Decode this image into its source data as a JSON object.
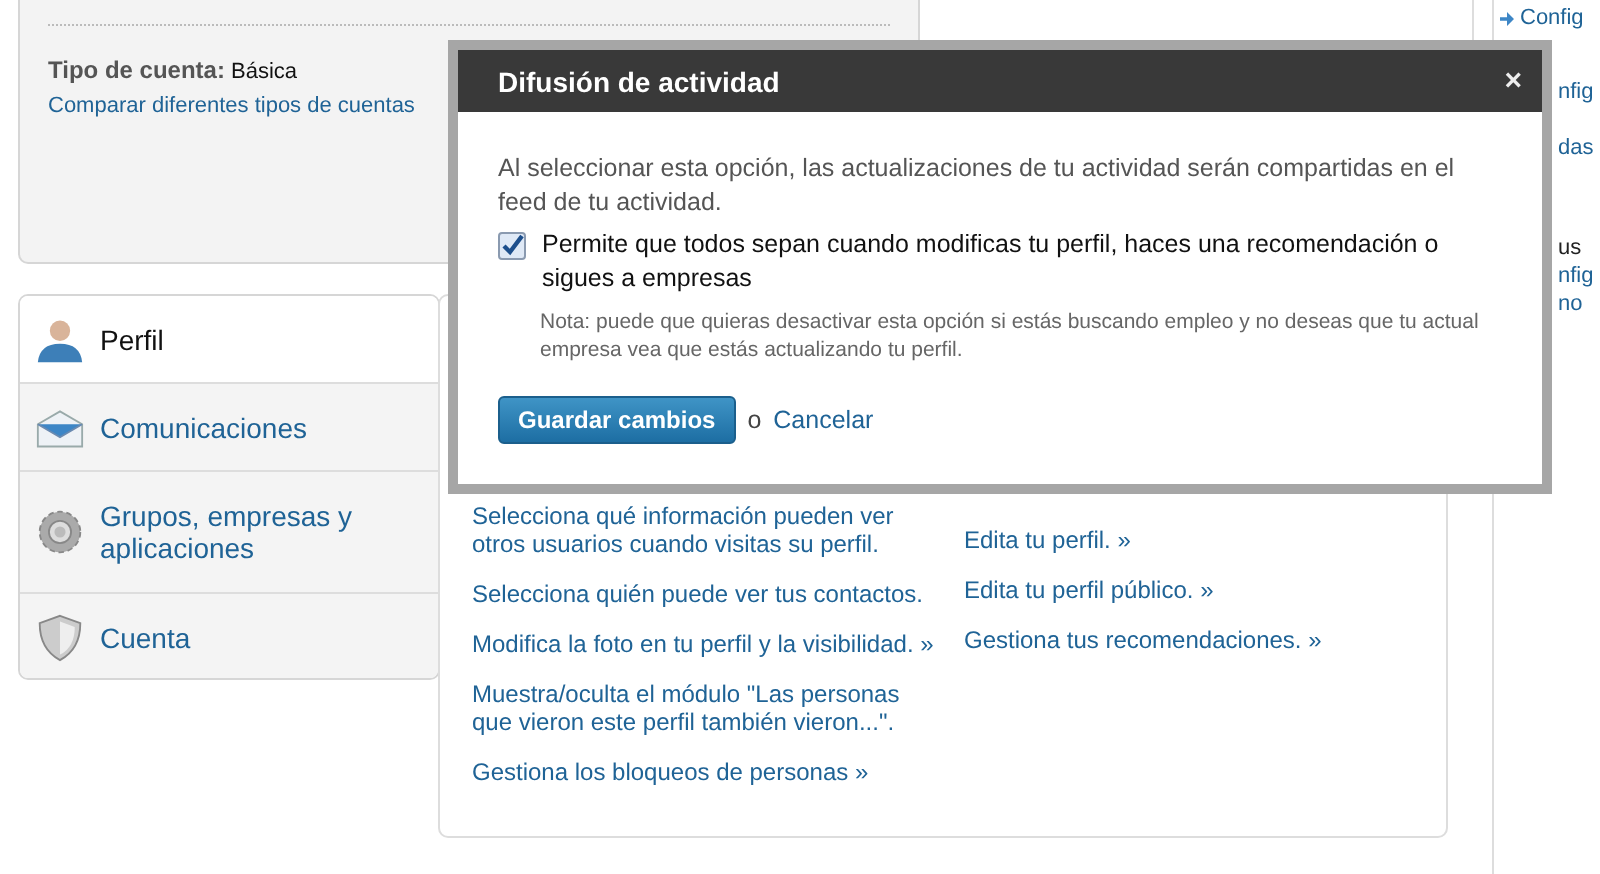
{
  "account": {
    "label": "Tipo de cuenta:",
    "value": "Básica",
    "link": "Comparar diferentes tipos de cuentas"
  },
  "sidebar": {
    "items": [
      {
        "label": "Perfil",
        "kind": "person",
        "selected": true
      },
      {
        "label": "Comunicaciones",
        "kind": "envelope",
        "selected": false
      },
      {
        "label": "Grupos, empresas y aplicaciones",
        "kind": "gear",
        "selected": false
      },
      {
        "label": "Cuenta",
        "kind": "shield",
        "selected": false
      }
    ]
  },
  "content": {
    "column_1": [
      "Selecciona qué información pueden ver otros usuarios cuando visitas su perfil.",
      "Selecciona quién puede ver tus contactos.",
      "Modifica la foto en tu perfil y la visibilidad. »",
      "Muestra/oculta el módulo \"Las personas que vieron este perfil también vieron...\".",
      "Gestiona los bloqueos de personas »"
    ],
    "column_2": [
      "Edita tu perfil. »",
      "Edita tu perfil público. »",
      "Gestiona tus recomendaciones. »"
    ]
  },
  "right_column": {
    "link": "Config",
    "fragments": [
      "nfig",
      "das",
      "us",
      "nfig",
      "no"
    ]
  },
  "modal": {
    "title": "Difusión de actividad",
    "close": "×",
    "description": "Al seleccionar esta opción, las actualizaciones de tu actividad serán compartidas en el feed de tu actividad.",
    "option": {
      "label": "Permite que todos sepan cuando modificas tu perfil, haces una recomendación o sigues a empresas",
      "checked": true
    },
    "note": "Nota: puede que quieras desactivar esta opción si estás buscando empleo y no deseas que tu actual empresa vea que estás actualizando tu perfil.",
    "save_button": "Guardar cambios",
    "separator": "o",
    "cancel": "Cancelar"
  }
}
